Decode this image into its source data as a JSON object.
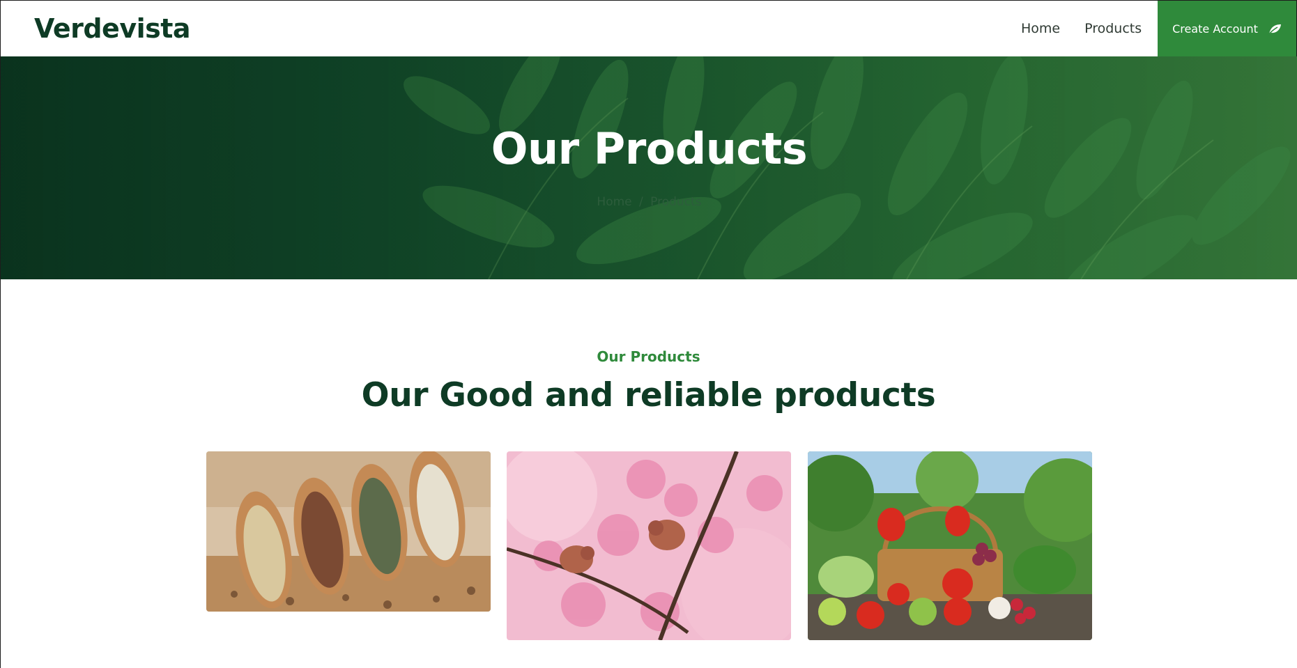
{
  "brand": {
    "name": "Verdevista"
  },
  "nav": {
    "links": [
      {
        "label": "Home"
      },
      {
        "label": "Products"
      }
    ],
    "cta_label": "Create Account",
    "cta_icon": "leaf-icon"
  },
  "hero": {
    "title": "Our Products",
    "breadcrumb": {
      "home": "Home",
      "separator": "/",
      "current": "Products"
    }
  },
  "section": {
    "tag": "Our Products",
    "title": "Our Good and reliable products"
  },
  "products": [
    {
      "image": "seeds-in-wooden-scoops"
    },
    {
      "image": "birds-on-pink-blossom-branch"
    },
    {
      "image": "vegetable-basket-in-garden"
    }
  ],
  "colors": {
    "brand_dark": "#0e3b25",
    "accent_green": "#2f8a3b",
    "hero_green": "#1d5a30"
  }
}
